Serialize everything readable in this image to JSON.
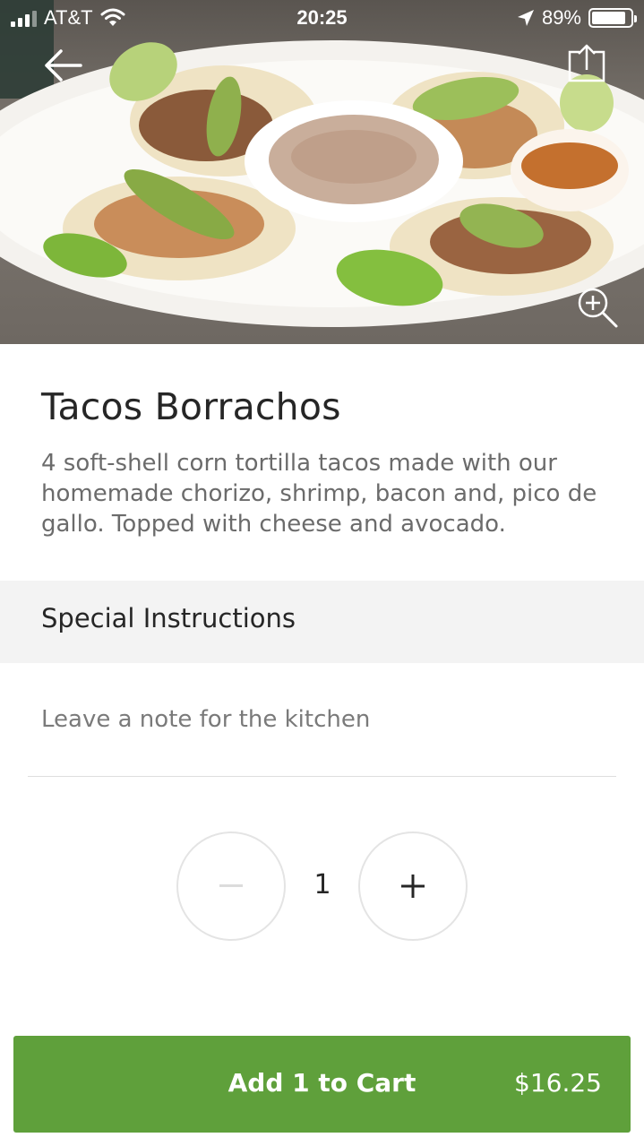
{
  "status_bar": {
    "carrier": "AT&T",
    "time": "20:25",
    "battery": "89%",
    "battery_level": 0.89,
    "icons": [
      "signal-icon",
      "wifi-icon",
      "location-arrow-icon",
      "battery-icon"
    ]
  },
  "hero": {
    "icons": [
      "back-arrow-icon",
      "share-icon",
      "zoom-in-icon"
    ]
  },
  "item": {
    "title": "Tacos Borrachos",
    "description": "4 soft-shell corn tortilla tacos made with our homemade chorizo, shrimp, bacon and, pico de gallo. Topped with cheese and avocado."
  },
  "special_instructions": {
    "header": "Special Instructions",
    "placeholder": "Leave a note for the kitchen"
  },
  "quantity": {
    "value": "1",
    "minus_icon": "minus-icon",
    "plus_icon": "plus-icon"
  },
  "cart_button": {
    "label": "Add 1 to Cart",
    "price": "$16.25",
    "color": "#5fa03b"
  }
}
